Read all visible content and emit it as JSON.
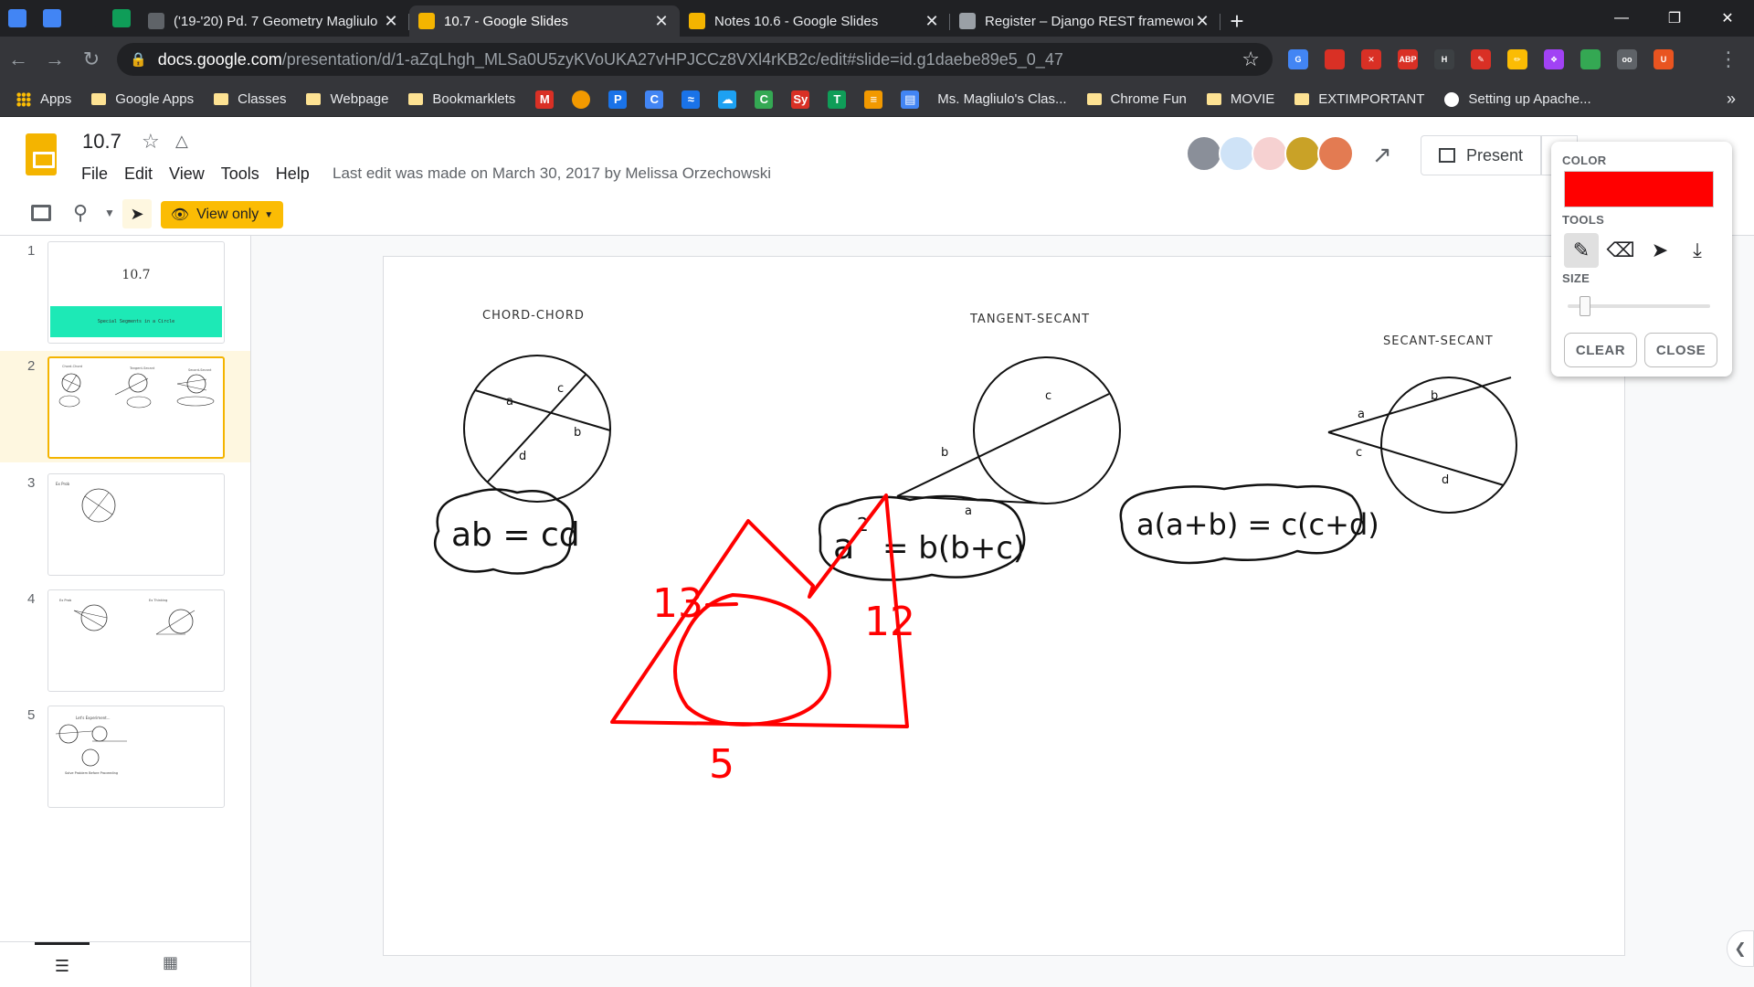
{
  "browser": {
    "pinned_tabs": [
      {
        "name": "docs-icon",
        "color": "#4285f4"
      },
      {
        "name": "docs-icon",
        "color": "#4285f4"
      },
      {
        "name": "github-icon",
        "color": "#202124"
      },
      {
        "name": "hangouts-icon",
        "color": "#0f9d58"
      }
    ],
    "tabs": [
      {
        "title": "('19-'20) Pd. 7 Geometry Magliulo",
        "favicon": "#5f6368",
        "active": false
      },
      {
        "title": "10.7 - Google Slides",
        "favicon": "#f4b400",
        "active": true
      },
      {
        "title": "Notes 10.6 - Google Slides",
        "favicon": "#f4b400",
        "active": false
      },
      {
        "title": "Register – Django REST framework",
        "favicon": "#9aa0a6",
        "active": false
      }
    ],
    "new_tab": "+",
    "url_domain": "docs.google.com",
    "url_path": "/presentation/d/1-aZqLhgh_MLSa0U5zyKVoUKA27vHPJCCz8VXl4rKB2c/edit#slide=id.g1daebe89e5_0_47",
    "extensions": [
      {
        "name": "translate-icon",
        "color": "#4285f4",
        "text": "G"
      },
      {
        "name": "book-icon",
        "color": "#d93025",
        "text": ""
      },
      {
        "name": "extension-icon",
        "color": "#d93025",
        "text": "✕"
      },
      {
        "name": "adblock-icon",
        "color": "#d93025",
        "text": "ABP"
      },
      {
        "name": "h-icon",
        "color": "#3c4043",
        "text": "H"
      },
      {
        "name": "pen-icon",
        "color": "#d93025",
        "text": "✎"
      },
      {
        "name": "highlighter-icon",
        "color": "#fbbc04",
        "text": "✏"
      },
      {
        "name": "color-icon",
        "color": "#a142f4",
        "text": "❖"
      },
      {
        "name": "drive-icon",
        "color": "#34a853",
        "text": ""
      },
      {
        "name": "glasses-icon",
        "color": "#5f6368",
        "text": "oo"
      },
      {
        "name": "ubuntu-icon",
        "color": "#e95420",
        "text": "U"
      }
    ],
    "bookmarks": [
      {
        "label": "Apps",
        "type": "apps"
      },
      {
        "label": "Google Apps",
        "type": "folder"
      },
      {
        "label": "Classes",
        "type": "folder"
      },
      {
        "label": "Webpage",
        "type": "folder"
      },
      {
        "label": "Bookmarklets",
        "type": "folder"
      }
    ],
    "bookmark_icons": [
      {
        "name": "gmail-icon",
        "color": "#d93025",
        "text": "M"
      },
      {
        "name": "circle-icon",
        "color": "#f29900",
        "text": ""
      },
      {
        "name": "p-icon",
        "color": "#1a73e8",
        "text": "P"
      },
      {
        "name": "c-icon",
        "color": "#4285f4",
        "text": "C"
      },
      {
        "name": "waves-icon",
        "color": "#1a73e8",
        "text": "≈"
      },
      {
        "name": "cloud-icon",
        "color": "#1da1f2",
        "text": "☁"
      },
      {
        "name": "circle-c-icon",
        "color": "#34a853",
        "text": "C"
      },
      {
        "name": "sy-icon",
        "color": "#d93025",
        "text": "Sy"
      },
      {
        "name": "t-icon",
        "color": "#0f9d58",
        "text": "T"
      },
      {
        "name": "rss-icon",
        "color": "#f29900",
        "text": "≡"
      },
      {
        "name": "classroom-icon",
        "color": "#4285f4",
        "text": "▤"
      }
    ],
    "bookmarks_after": [
      {
        "label": "Ms. Magliulo's Clas...",
        "type": "none"
      },
      {
        "label": "Chrome Fun",
        "type": "folder"
      },
      {
        "label": "MOVIE",
        "type": "folder"
      },
      {
        "label": "EXTIMPORTANT",
        "type": "folder"
      },
      {
        "label": "Setting up Apache...",
        "type": "google"
      }
    ],
    "bookmarks_more": "»"
  },
  "slides": {
    "doc_title": "10.7",
    "menu": [
      "File",
      "Edit",
      "View",
      "Tools",
      "Help"
    ],
    "last_edit": "Last edit was made on March 30, 2017 by Melissa Orzechowski",
    "present_label": "Present",
    "view_only_label": "View only",
    "avatar_colors": [
      "#8a8f99",
      "#cfe3f7",
      "#f6d1d1",
      "#c9a227",
      "#e37b52"
    ],
    "thumbnails": [
      {
        "num": "1",
        "title": "10.7",
        "subtitle": "Special Segments in a Circle"
      },
      {
        "num": "2",
        "labels": [
          "Chord-Chord",
          "Tangent-Secant",
          "Secant-Secant"
        ]
      },
      {
        "num": "3",
        "title": "Ex Prob"
      },
      {
        "num": "4",
        "labels": [
          "Ex Prob",
          "Ex Thinking"
        ]
      },
      {
        "num": "5",
        "title": "Let's Experiment...",
        "footer": "Solve Problem Before Proceeding"
      }
    ]
  },
  "slide_content": {
    "chord_title": "CHORD-CHORD",
    "tangent_title": "TANGENT-SECANT",
    "secant_title": "SECANT-SECANT",
    "chord_labels": [
      "a",
      "c",
      "b",
      "d"
    ],
    "tangent_labels": [
      "c",
      "b",
      "a"
    ],
    "secant_labels": [
      "b",
      "a",
      "c",
      "d"
    ],
    "formula_chord": "ab = cd",
    "formula_tangent_base": "a",
    "formula_tangent_exp": "2",
    "formula_tangent_rest": "= b(b+c)",
    "formula_secant": "a(a+b) = c(c+d)",
    "red_labels": [
      "13",
      "12",
      "5"
    ],
    "ink_color": "#ff0000"
  },
  "draw_panel": {
    "color_label": "COLOR",
    "tools_label": "TOOLS",
    "size_label": "SIZE",
    "clear_label": "CLEAR",
    "close_label": "CLOSE",
    "selected_color": "#ff0000",
    "size_level": 0.12
  }
}
